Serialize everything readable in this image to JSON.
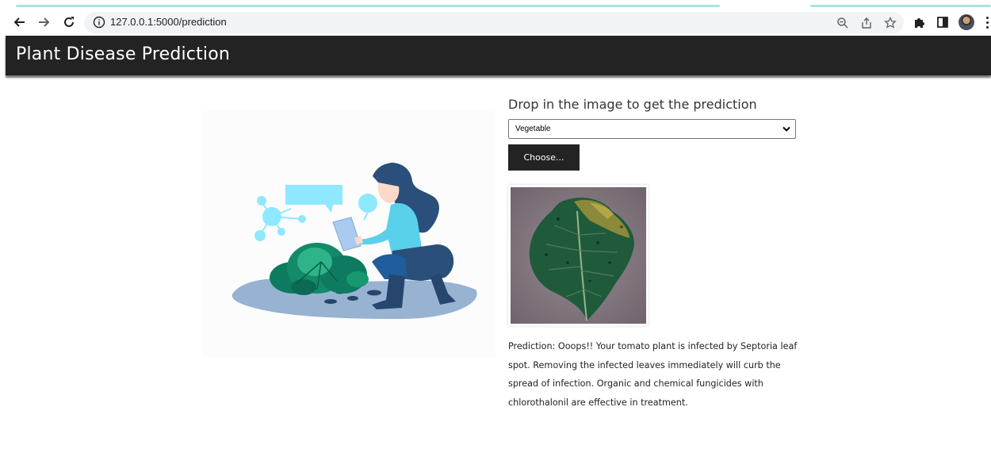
{
  "browser": {
    "url": "127.0.0.1:5000/prediction",
    "icons": [
      "back-arrow-icon",
      "forward-arrow-icon",
      "reload-icon",
      "info-icon",
      "zoom-icon",
      "share-icon",
      "star-icon",
      "puzzle-icon",
      "side-panel-icon",
      "avatar",
      "kebab-menu-icon"
    ]
  },
  "header": {
    "title": "Plant Disease Prediction"
  },
  "main": {
    "drop_title": "Drop in the image to get the prediction",
    "category": {
      "selected": "Vegetable"
    },
    "choose_label": "Choose...",
    "prediction_text": "Prediction: Ooops!! Your tomato plant is infected by Septoria leaf spot. Removing the infected leaves immediately will curb the spread of infection. Organic and chemical fungicides with chlorothalonil are effective in treatment."
  },
  "colors": {
    "header_bg": "#232323",
    "button_bg": "#232323",
    "tab_accent": "#a7e3e8",
    "omnibox_bg": "#f1f3f4"
  }
}
